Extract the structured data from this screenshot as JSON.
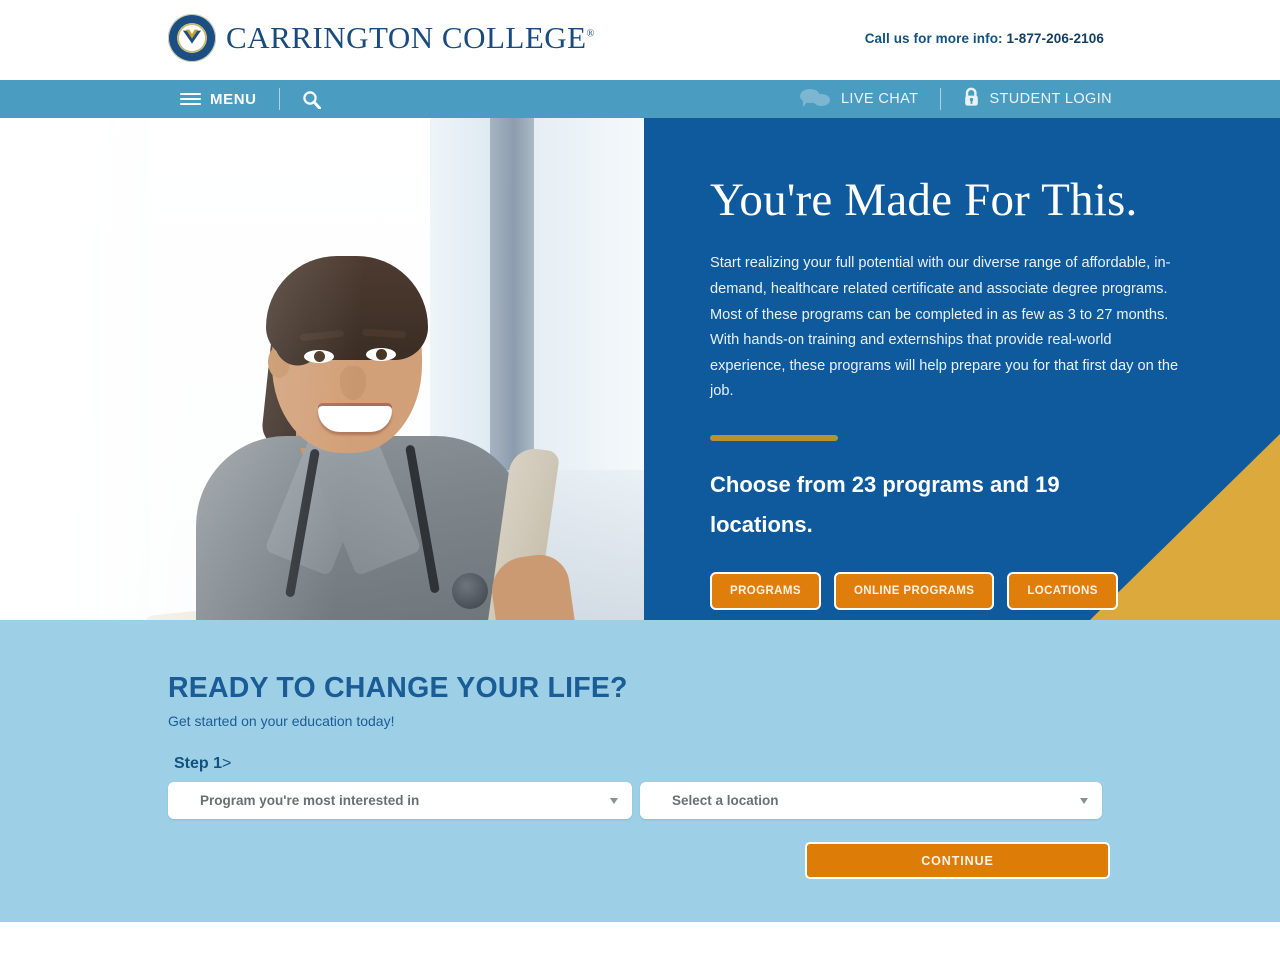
{
  "header": {
    "logo": {
      "seal_icon": "carrington-seal-icon",
      "brand": "CARRINGTON COLLEGE",
      "trademark": "®"
    },
    "call_label": "Call us for more info:",
    "phone": "1-877-206-2106"
  },
  "nav": {
    "menu_icon": "hamburger-icon",
    "menu_label": "MENU",
    "search_icon": "search-icon",
    "live_chat_icon": "chat-bubble-icon",
    "live_chat_label": "LIVE CHAT",
    "student_login_icon": "lock-icon",
    "student_login_label": "STUDENT LOGIN"
  },
  "hero": {
    "image_alt": "smiling-nursing-student-with-stethoscope",
    "headline": "You're Made For This.",
    "paragraph": "Start realizing your full potential with our diverse range of affordable, in-demand, healthcare related certificate and associate degree programs. Most of these programs can be completed in as few as 3 to 27 months. With hands-on training and externships that provide real-world experience, these programs will help prepare you for that first day on the job.",
    "subheadline": "Choose from 23 programs and 19 locations.",
    "program_count": 23,
    "location_count": 19,
    "buttons": [
      {
        "label": "PROGRAMS"
      },
      {
        "label": "ONLINE PROGRAMS"
      },
      {
        "label": "LOCATIONS"
      }
    ],
    "colors": {
      "panel_blue": "#0f5a9c",
      "wedge_gold": "#dca93c",
      "rule_gold": "#b7932f",
      "button_orange": "#e07e0b"
    }
  },
  "form": {
    "title": "READY TO CHANGE YOUR LIFE?",
    "subtitle": "Get started on your education today!",
    "step_label": "Step 1",
    "step_chevron": ">",
    "program_select": {
      "value": "Program you're most interested in",
      "caret_icon": "chevron-down-icon"
    },
    "location_select": {
      "value": "Select a location",
      "caret_icon": "chevron-down-icon"
    },
    "continue_label": "CONTINUE",
    "colors": {
      "section_bg": "#9dd0e7",
      "heading_blue": "#1a5c96",
      "continue_orange": "#dd7c07"
    }
  }
}
